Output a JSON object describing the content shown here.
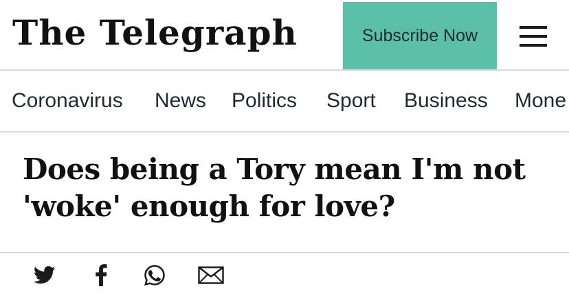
{
  "header": {
    "logo_text": "The Telegraph",
    "subscribe_label": "Subscribe Now",
    "menu_icon": "hamburger-menu-icon"
  },
  "nav": {
    "items": [
      {
        "label": "Coronavirus"
      },
      {
        "label": "News"
      },
      {
        "label": "Politics"
      },
      {
        "label": "Sport"
      },
      {
        "label": "Business"
      },
      {
        "label": "Mone"
      }
    ]
  },
  "article": {
    "headline": "Does being a Tory mean I'm not 'woke' enough for love?"
  },
  "share": {
    "icons": [
      "twitter-icon",
      "facebook-icon",
      "whatsapp-icon",
      "email-icon"
    ]
  },
  "colors": {
    "subscribe_bg": "#5bbfa9",
    "divider": "#d9d9d9",
    "text": "#1a1a1a"
  }
}
